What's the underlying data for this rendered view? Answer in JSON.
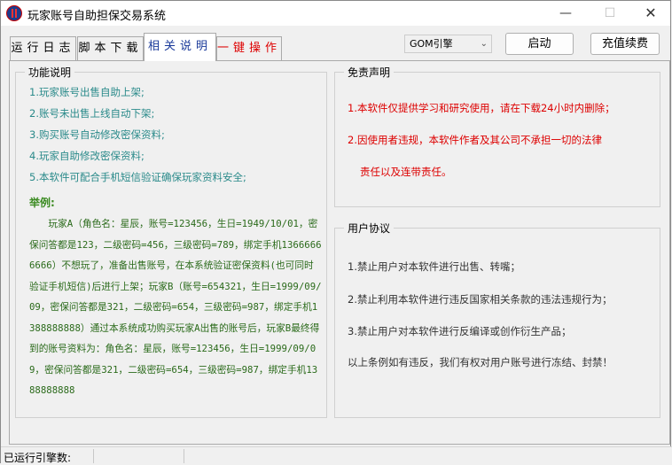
{
  "window": {
    "title": "玩家账号自助担保交易系统",
    "minimize": "—",
    "maximize": "☐",
    "close": "✕"
  },
  "tabs": [
    {
      "label": "运行日志",
      "color": "#000000"
    },
    {
      "label": "脚本下载",
      "color": "#000000"
    },
    {
      "label": "相关说明",
      "color": "#1a3a9a",
      "active": true
    },
    {
      "label": "一键操作",
      "color": "#dd0000"
    }
  ],
  "toolbar": {
    "engine_value": "GOM引擎",
    "start_label": "启动",
    "recharge_label": "充值续费"
  },
  "features": {
    "title": "功能说明",
    "items": [
      "1.玩家账号出售自助上架;",
      "2.账号未出售上线自动下架;",
      "3.购买账号自动修改密保资料;",
      "4.玩家自助修改密保资料;",
      "5.本软件可配合手机短信验证确保玩家资料安全;"
    ],
    "example_title": "举例:",
    "example_text": "玩家A（角色名：星辰，账号=123456，生日=1949/10/01，密保问答都是123，二级密码=456，三级密码=789，绑定手机13666666666）不想玩了，准备出售账号，在本系统验证密保资料(也可同时验证手机短信)后进行上架；玩家B（账号=654321，生日=1999/09/09，密保问答都是321，二级密码=654，三级密码=987，绑定手机1388888888）通过本系统成功购买玩家A出售的账号后，玩家B最终得到的账号资料为：角色名：星辰，账号=123456，生日=1999/09/09，密保问答都是321，二级密码=654，三级密码=987，绑定手机1388888888"
  },
  "disclaimer": {
    "title": "免责声明",
    "lines": [
      "1.本软件仅提供学习和研究使用，请在下载24小时内删除；",
      "2.因使用者违规，本软件作者及其公司不承担一切的法律",
      "责任以及连带责任。"
    ]
  },
  "agreement": {
    "title": "用户协议",
    "lines": [
      "1.禁止用户对本软件进行出售、转嘴；",
      "2.禁止利用本软件进行违反国家相关条款的违法违规行为；",
      "3.禁止用户对本软件进行反编译或创作衍生产品；",
      "以上条例如有违反，我们有权对用户账号进行冻结、封禁！"
    ]
  },
  "status": {
    "label": "已运行引擎数:"
  },
  "colors": {
    "feature_text": "#2a8a8a",
    "example_text": "#2a6a1a",
    "disclaimer_text": "#dd0000",
    "active_tab": "#1a3a9a"
  }
}
